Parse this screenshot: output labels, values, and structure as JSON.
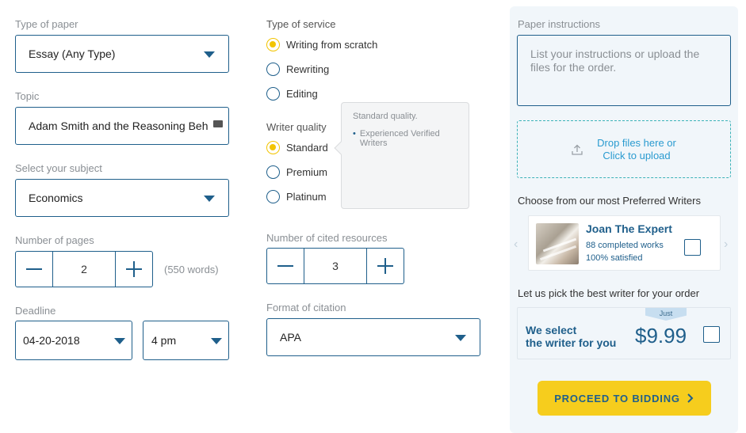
{
  "paper_type": {
    "label": "Type of paper",
    "value": "Essay (Any Type)"
  },
  "topic": {
    "label": "Topic",
    "value": "Adam Smith and the Reasoning Beh"
  },
  "subject": {
    "label": "Select your subject",
    "value": "Economics"
  },
  "pages": {
    "label": "Number of pages",
    "value": "2",
    "words_note": "(550 words)"
  },
  "deadline": {
    "label": "Deadline",
    "date": "04-20-2018",
    "time": "4 pm"
  },
  "service": {
    "label": "Type of service",
    "options": [
      "Writing from scratch",
      "Rewriting",
      "Editing"
    ],
    "selected": "Writing from scratch"
  },
  "writer_quality": {
    "label": "Writer quality",
    "options": [
      "Standard",
      "Premium",
      "Platinum"
    ],
    "selected": "Standard",
    "tooltip": {
      "title": "Standard quality.",
      "bullet": "Experienced Verified Writers"
    }
  },
  "cited": {
    "label": "Number of cited resources",
    "value": "3"
  },
  "citation": {
    "label": "Format of citation",
    "value": "APA"
  },
  "instructions": {
    "label": "Paper instructions",
    "placeholder": "List your instructions or upload the files for the order."
  },
  "upload": {
    "line1": "Drop files here or",
    "line2": "Click to upload"
  },
  "preferred": {
    "heading": "Choose from our most Preferred Writers",
    "name": "Joan The Expert",
    "works": "88 completed works",
    "satisfied": "100% satisfied"
  },
  "pick_best": {
    "heading": "Let us pick the best writer for your order",
    "text_line1": "We select",
    "text_line2": "the writer for you",
    "ribbon": "Just",
    "price": "$9.99"
  },
  "proceed": {
    "label": "PROCEED TO BIDDING"
  },
  "colors": {
    "primary": "#1f5f8b",
    "accent": "#f2c400",
    "link": "#2a9bd0",
    "teal": "#3bb2b8"
  }
}
